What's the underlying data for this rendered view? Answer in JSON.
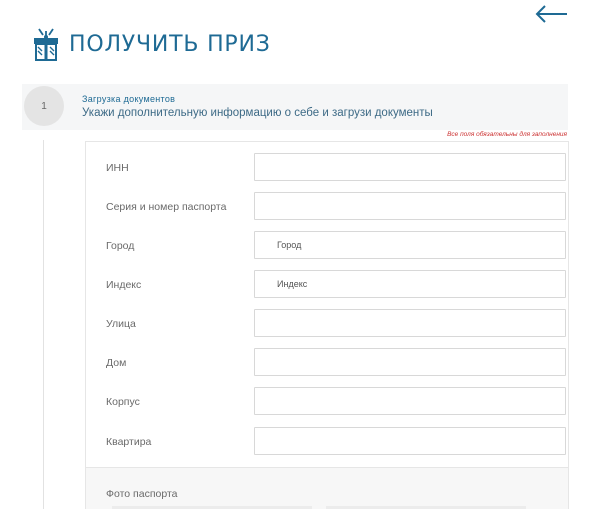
{
  "header": {
    "title": "ПОЛУЧИТЬ ПРИЗ"
  },
  "icons": {
    "back": "arrow-left-icon",
    "title": "gift-icon"
  },
  "colors": {
    "accent": "#1e6a94",
    "required": "#cc3333",
    "step_bg": "#f5f6f7"
  },
  "step": {
    "number": "1",
    "title": "Загрузка документов",
    "description": "Укажи дополнительную информацию о себе и загрузи документы"
  },
  "required_note": "Все поля обязательны для заполнения",
  "form": {
    "fields": [
      {
        "label": "ИНН",
        "value": "",
        "placeholder": ""
      },
      {
        "label": "Серия и номер паспорта",
        "value": "",
        "placeholder": ""
      },
      {
        "label": "Город",
        "value": "",
        "placeholder": "Город"
      },
      {
        "label": "Индекс",
        "value": "",
        "placeholder": "Индекс"
      },
      {
        "label": "Улица",
        "value": "",
        "placeholder": ""
      },
      {
        "label": "Дом",
        "value": "",
        "placeholder": ""
      },
      {
        "label": "Корпус",
        "value": "",
        "placeholder": ""
      },
      {
        "label": "Квартира",
        "value": "",
        "placeholder": ""
      }
    ]
  },
  "photo": {
    "label": "Фото паспорта"
  }
}
